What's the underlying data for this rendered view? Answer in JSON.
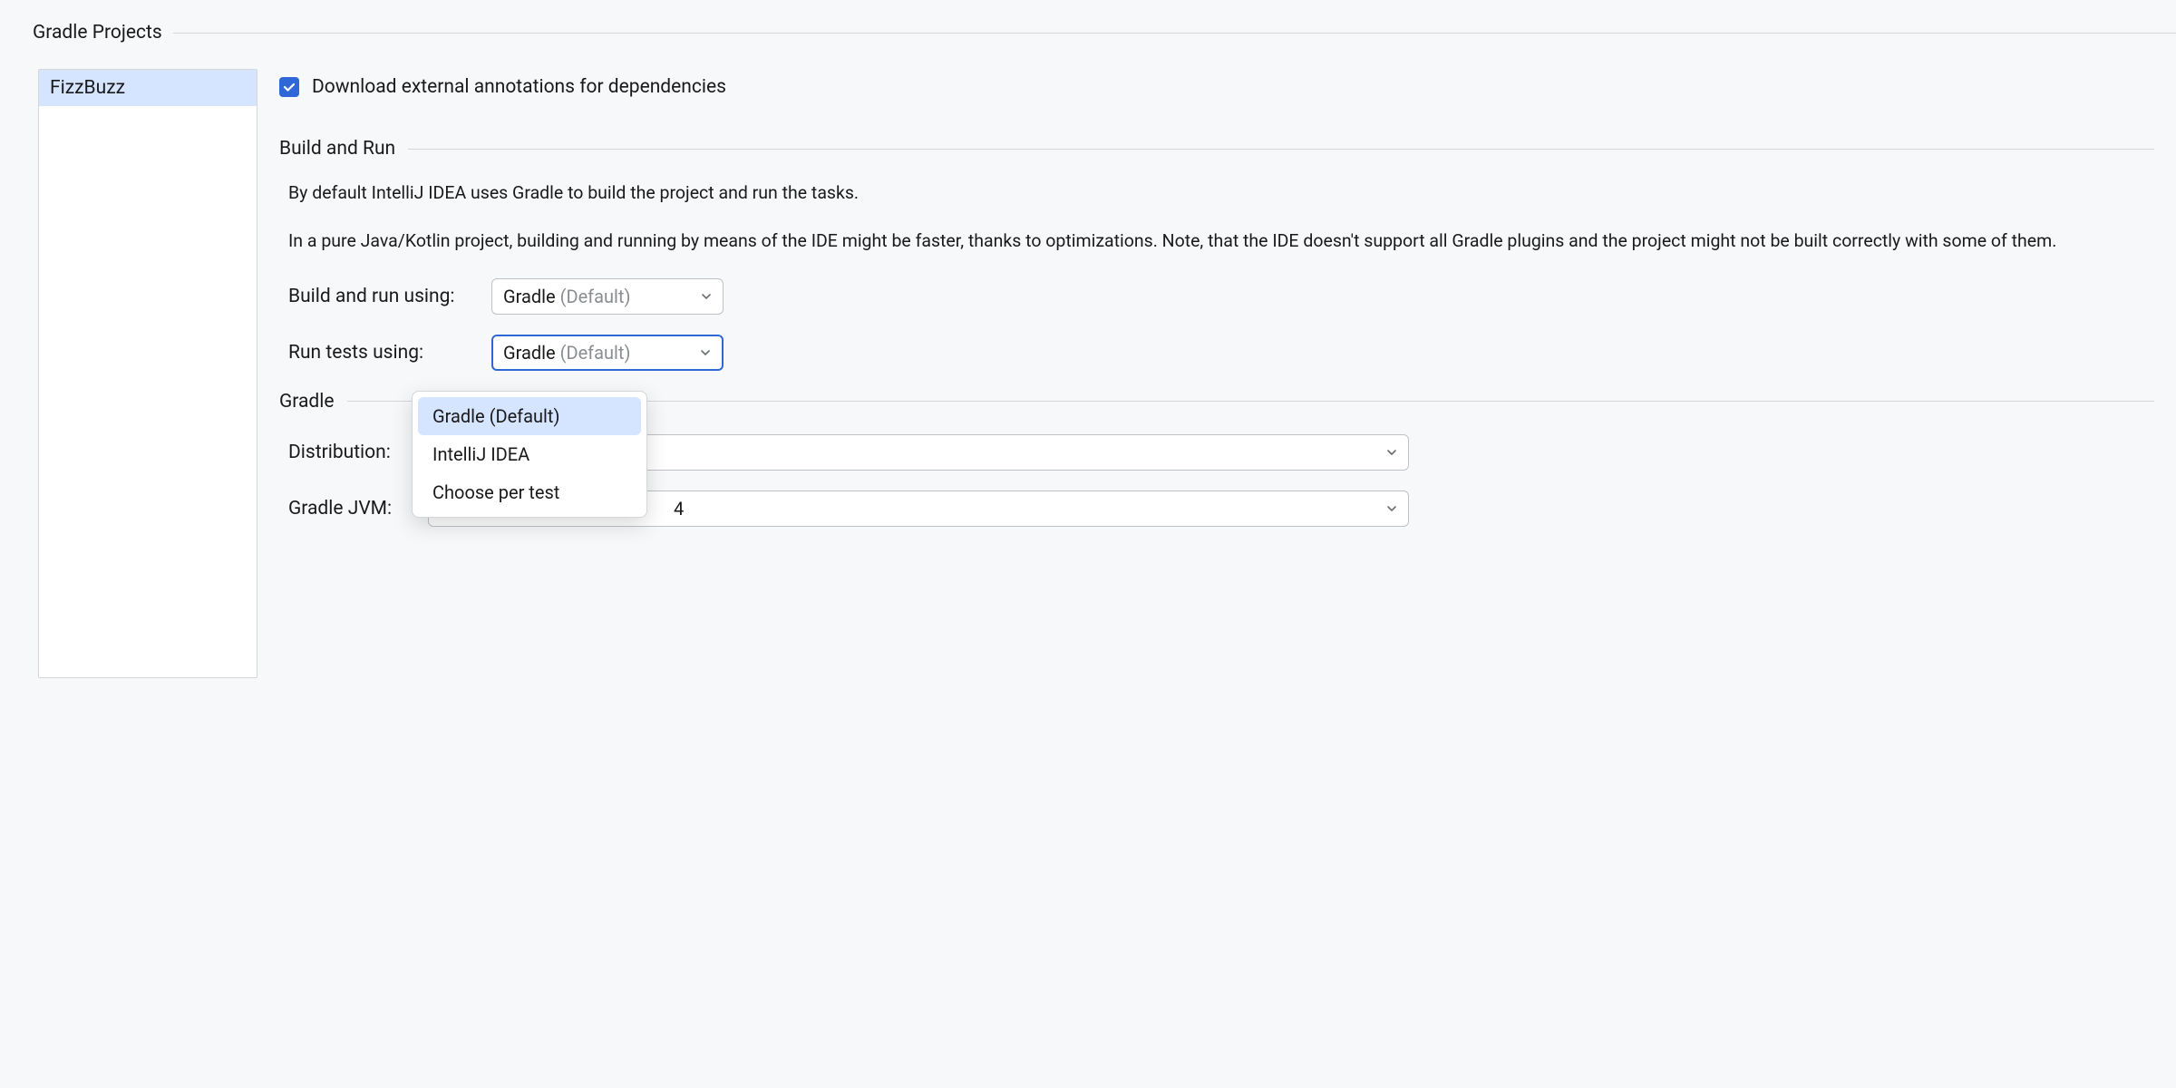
{
  "panel": {
    "title": "Gradle Projects"
  },
  "sidebar": {
    "items": [
      {
        "label": "FizzBuzz",
        "selected": true
      }
    ]
  },
  "download_annotations": {
    "checked": true,
    "label": "Download external annotations for dependencies"
  },
  "build_run": {
    "title": "Build and Run",
    "desc1": "By default IntelliJ IDEA uses Gradle to build the project and run the tasks.",
    "desc2": "In a pure Java/Kotlin project, building and running by means of the IDE might be faster, thanks to optimizations. Note, that the IDE doesn't support all Gradle plugins and the project might not be built correctly with some of them.",
    "build_label": "Build and run using:",
    "tests_label": "Run tests using:",
    "combo_value": "Gradle",
    "combo_hint": " (Default)"
  },
  "gradle": {
    "title": "Gradle",
    "dist_label": "Distribution:",
    "jvm_label": "Gradle JVM:",
    "jvm_visible_fragment": "4"
  },
  "dropdown": {
    "options": [
      "Gradle (Default)",
      "IntelliJ IDEA",
      "Choose per test"
    ]
  }
}
